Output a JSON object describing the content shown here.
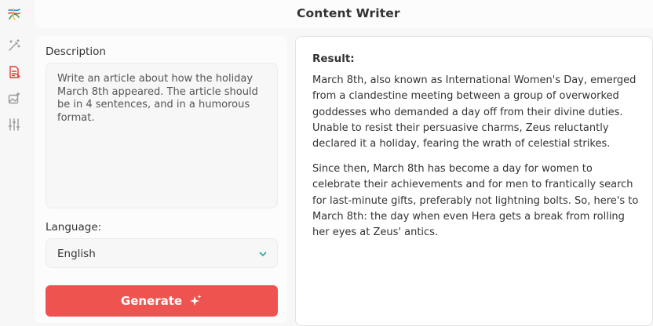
{
  "header": {
    "title": "Content Writer"
  },
  "sidebar": {
    "items": [
      {
        "name": "logo",
        "icon": "swirl-logo-icon"
      },
      {
        "name": "magic",
        "icon": "magic-wand-icon"
      },
      {
        "name": "content-writer",
        "icon": "document-icon",
        "active": true
      },
      {
        "name": "image",
        "icon": "image-sparkle-icon"
      },
      {
        "name": "settings",
        "icon": "sliders-icon"
      }
    ]
  },
  "form": {
    "description_label": "Description",
    "description_value": "Write an article about how the holiday March 8th appeared. The article should be in 4 sentences, and in a humorous format.",
    "language_label": "Language:",
    "language_value": "English",
    "generate_label": "Generate"
  },
  "result": {
    "label": "Result:",
    "paragraphs": [
      "March 8th, also known as International Women's Day, emerged from a clandestine meeting between a group of overworked goddesses who demanded a day off from their divine duties. Unable to resist their persuasive charms, Zeus reluctantly declared it a holiday, fearing the wrath of celestial strikes.",
      "Since then, March 8th has become a day for women to celebrate their achievements and for men to frantically search for last-minute gifts, preferably not lightning bolts. So, here's to March 8th: the day when even Hera gets a break from rolling her eyes at Zeus' antics."
    ]
  },
  "colors": {
    "accent": "#ef5350",
    "active_icon": "#e53935",
    "chevron": "#26a69a"
  }
}
